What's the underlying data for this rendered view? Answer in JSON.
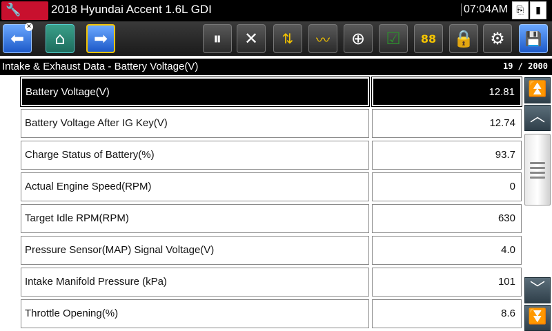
{
  "titlebar": {
    "vehicle": "2018 Hyundai Accent 1.6L GDI",
    "time": "07:04AM"
  },
  "toolbar": {
    "buttons": [
      {
        "name": "back-button",
        "icon": "back-arrow-icon"
      },
      {
        "name": "home-button",
        "icon": "home-icon"
      },
      {
        "name": "forward-button",
        "icon": "forward-arrow-icon"
      },
      {
        "name": "pause-button",
        "icon": "pause-icon"
      },
      {
        "name": "clear-button",
        "icon": "close-icon"
      },
      {
        "name": "sort-button",
        "icon": "sort-icon"
      },
      {
        "name": "graph-button",
        "icon": "graph-icon"
      },
      {
        "name": "zoom-button",
        "icon": "zoom-icon"
      },
      {
        "name": "select-button",
        "icon": "checkmark-icon"
      },
      {
        "name": "units-button",
        "icon": "units-icon"
      },
      {
        "name": "lock-button",
        "icon": "lock-icon"
      },
      {
        "name": "settings-button",
        "icon": "gear-icon"
      },
      {
        "name": "save-button",
        "icon": "save-icon"
      }
    ],
    "units_text": "88"
  },
  "header": {
    "title": "Intake & Exhaust Data - Battery Voltage(V)",
    "counter": "19 / 2000"
  },
  "rows": [
    {
      "name": "Battery Voltage(V)",
      "value": "12.81",
      "selected": true
    },
    {
      "name": "Battery Voltage After IG Key(V)",
      "value": "12.74"
    },
    {
      "name": "Charge Status of Battery(%)",
      "value": "93.7"
    },
    {
      "name": "Actual Engine Speed(RPM)",
      "value": "0"
    },
    {
      "name": "Target Idle RPM(RPM)",
      "value": "630"
    },
    {
      "name": "Pressure Sensor(MAP) Signal Voltage(V)",
      "value": "4.0"
    },
    {
      "name": "Intake Manifold Pressure (kPa)",
      "value": "101"
    },
    {
      "name": "Throttle Opening(%)",
      "value": "8.6"
    }
  ],
  "colors": {
    "titlebar": "#000000",
    "logo": "#c8102e",
    "selected_row": "#000000",
    "toolbar_blue": "#1d59c8",
    "toolbar_highlight": "#f5c400"
  }
}
